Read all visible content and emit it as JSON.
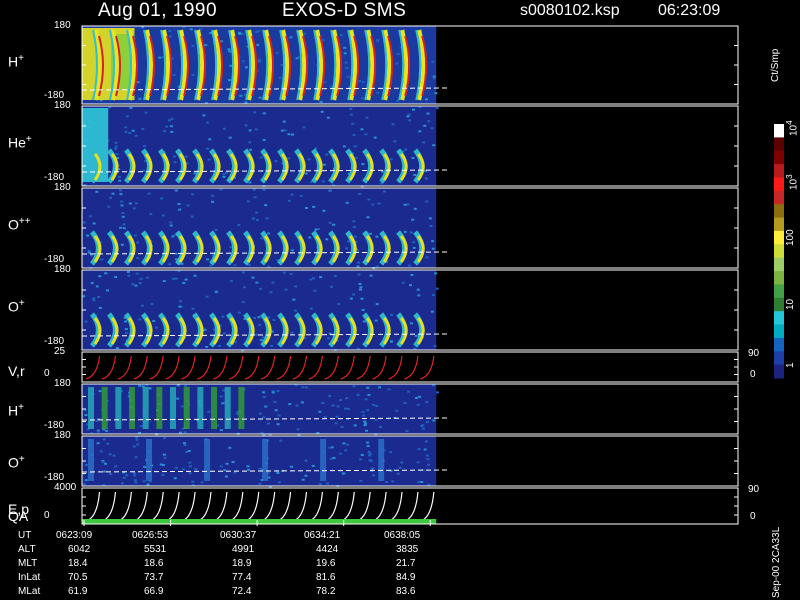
{
  "header": {
    "date": "Aug 01, 1990",
    "instrument": "EXOS-D SMS",
    "file": "s0080102.ksp",
    "time": "06:23:09"
  },
  "colorbar": {
    "title": "Ct/Smp",
    "ticks": [
      "1",
      "10",
      "100",
      "10",
      "10"
    ],
    "tick_exponents": [
      "",
      "",
      "",
      "3",
      "4"
    ],
    "colors": [
      "#1a237e",
      "#1e3fa8",
      "#1565c0",
      "#00acc1",
      "#26c6da",
      "#2e7d32",
      "#43a047",
      "#7cb342",
      "#9ccc65",
      "#cddc39",
      "#ffeb3b",
      "#b59a1f",
      "#8d6e0f",
      "#c62828",
      "#ff1a1a",
      "#b71c1c",
      "#7f0000",
      "#5d0000",
      "#ffffff"
    ]
  },
  "footer_note": "Sep-00 2CA33L",
  "chart_data": {
    "type": "heatmap",
    "time_axis": {
      "ticks": [
        "0623:09",
        "0626:53",
        "0630:37",
        "0634:21",
        "0638:05"
      ],
      "data_end_fraction": 0.54
    },
    "panels": [
      {
        "id": "h-plus",
        "label": "H",
        "sup": "+",
        "ymax": "180",
        "ymin": "-180",
        "ring_count": 20,
        "base_level": "cyan",
        "background_level": "deep-blue",
        "lead_block": "yellow",
        "lead_fraction": 0.08
      },
      {
        "id": "he-plus",
        "label": "He",
        "sup": "+",
        "ymax": "180",
        "ymin": "-180",
        "ring_count": 20,
        "base_level": "navy",
        "background_level": "navy",
        "lead_block": "cyan",
        "lead_fraction": 0.04
      },
      {
        "id": "o-plusplus",
        "label": "O",
        "sup": "++",
        "ymax": "180",
        "ymin": "-180",
        "ring_count": 20,
        "base_level": "navy",
        "background_level": "navy",
        "lead_block": "",
        "lead_fraction": 0
      },
      {
        "id": "o-plus",
        "label": "O",
        "sup": "+",
        "ymax": "180",
        "ymin": "-180",
        "ring_count": 20,
        "base_level": "navy",
        "background_level": "navy",
        "lead_block": "",
        "lead_fraction": 0
      },
      {
        "id": "vr",
        "label": "V,r",
        "sup": "",
        "ymax": "25",
        "ymin": "0",
        "right_max": "90",
        "right_min": "0",
        "line_count": 22
      },
      {
        "id": "h-plus-2",
        "label": "H",
        "sup": "+",
        "ymax": "180",
        "ymin": "-180",
        "band_count": 12
      },
      {
        "id": "o-plus-2",
        "label": "O",
        "sup": "+",
        "ymax": "180",
        "ymin": "-180",
        "band_count": 6
      },
      {
        "id": "ep",
        "label": "E,p",
        "sup": "",
        "label2": "QA",
        "ymax": "4000",
        "ymin": "0",
        "right_max": "90",
        "right_min": "0",
        "line_count": 22
      }
    ],
    "ephemeris": {
      "rows": [
        {
          "name": "UT",
          "values": [
            "0623:09",
            "0626:53",
            "0630:37",
            "0634:21",
            "0638:05"
          ]
        },
        {
          "name": "ALT",
          "values": [
            "6042",
            "5531",
            "4991",
            "4424",
            "3835"
          ]
        },
        {
          "name": "MLT",
          "values": [
            "18.4",
            "18.6",
            "18.9",
            "19.6",
            "21.7"
          ]
        },
        {
          "name": "InLat",
          "values": [
            "70.5",
            "73.7",
            "77.4",
            "81.6",
            "84.9"
          ]
        },
        {
          "name": "MLat",
          "values": [
            "61.9",
            "66.9",
            "72.4",
            "78.2",
            "83.6"
          ]
        }
      ]
    }
  }
}
